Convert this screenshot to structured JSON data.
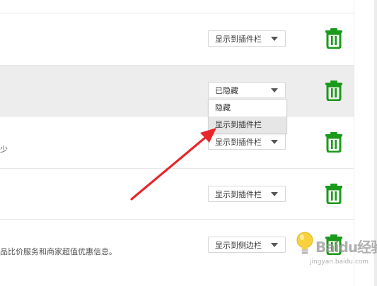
{
  "rows": [
    {
      "description": "",
      "select_value": "显示到插件栏"
    },
    {
      "description": "",
      "select_value": "已隐藏"
    },
    {
      "description": "少",
      "select_value": "显示到插件栏"
    },
    {
      "description": "",
      "select_value": "显示到插件栏"
    },
    {
      "description": "品比价服务和商家超值优惠信息。",
      "select_value": "显示到侧边栏"
    }
  ],
  "dropdown": {
    "options": [
      "隐藏",
      "显示到插件栏"
    ],
    "hovered_index": 1
  },
  "icons": {
    "delete": "trash-icon",
    "caret": "caret-down-icon",
    "tip": "lightbulb-icon"
  },
  "colors": {
    "trash_green": "#1a9a1a",
    "arrow_red": "#e8262a",
    "highlight_row": "#ededed"
  },
  "watermark": {
    "brand": "Baidu经验",
    "url": "jingyan.baidu.com"
  }
}
